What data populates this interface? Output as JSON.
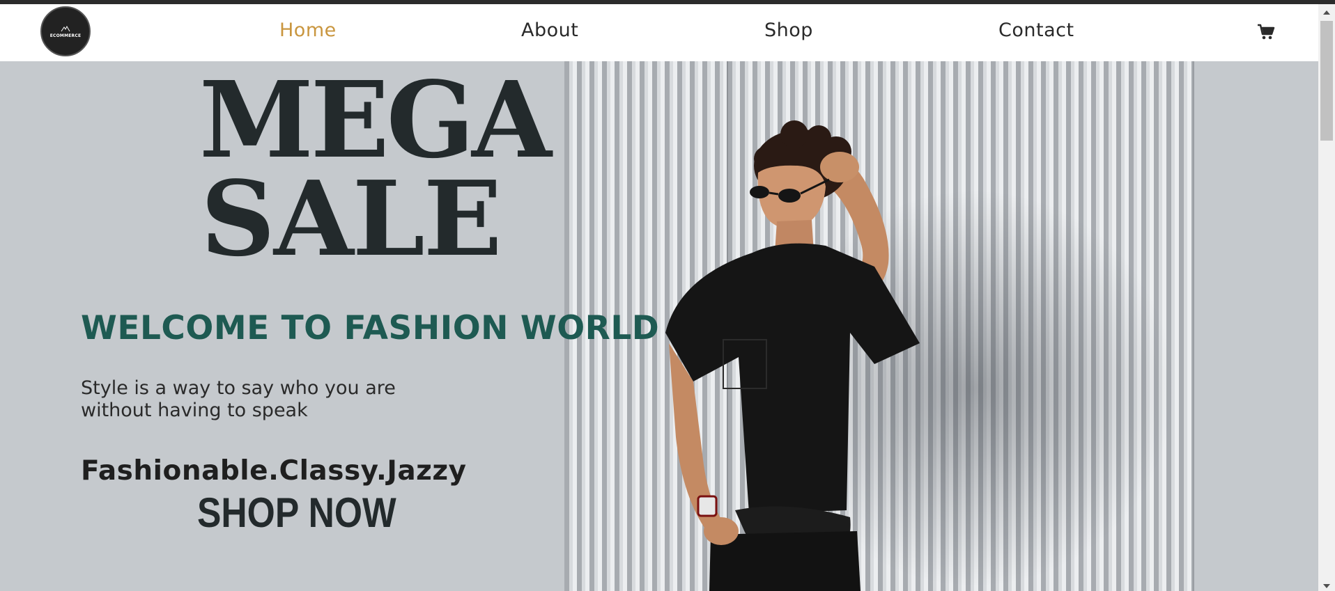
{
  "nav": {
    "logo_text": "ECOMMERCE",
    "links": [
      {
        "label": "Home",
        "active": true
      },
      {
        "label": "About",
        "active": false
      },
      {
        "label": "Shop",
        "active": false
      },
      {
        "label": "Contact",
        "active": false
      }
    ],
    "cart_icon": "cart-icon",
    "active_color": "#c9963f"
  },
  "hero": {
    "headline_line1": "MEGA",
    "headline_line2": "SALE",
    "welcome": "WELCOME TO FASHION WORLD",
    "tagline_line1": "Style is a way to say who you are",
    "tagline_line2": "without having to speak",
    "slogan": "Fashionable.Classy.Jazzy",
    "cta": "SHOP NOW",
    "welcome_color": "#1e5a52",
    "headline_color": "#232a2c"
  }
}
